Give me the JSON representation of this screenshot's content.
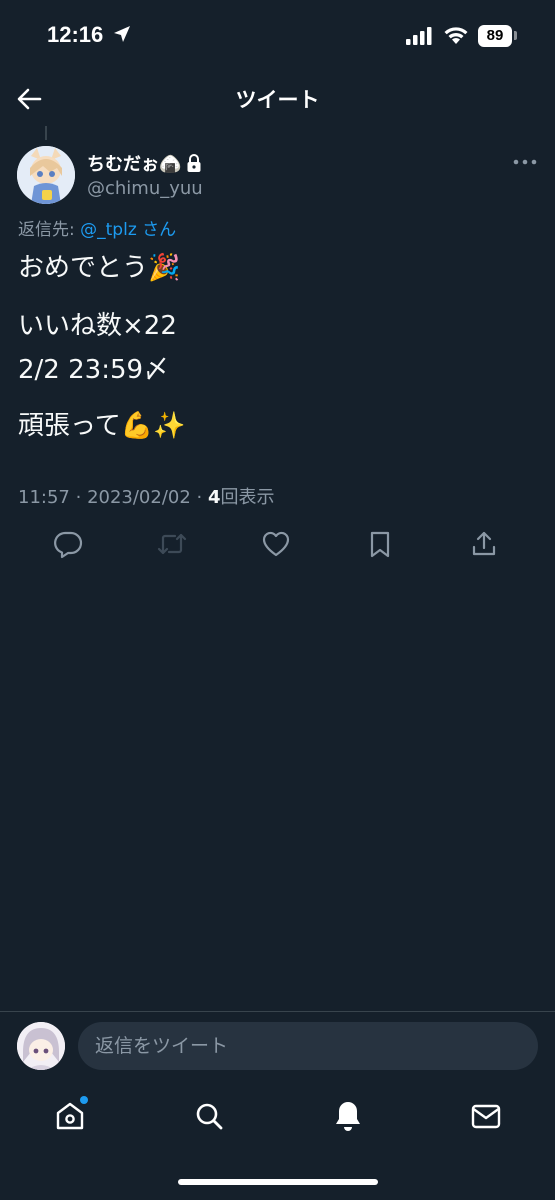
{
  "status_bar": {
    "time": "12:16",
    "battery": "89"
  },
  "header": {
    "title": "ツイート"
  },
  "tweet": {
    "display_name": "ちむだぉ🍙",
    "handle": "@chimu_yuu",
    "reply_prefix": "返信先: ",
    "reply_mention": "@_tplz",
    "reply_suffix": " さん",
    "lines": [
      "おめでとう🎉",
      "いいね数×22",
      "2/2 23:59〆",
      "頑張って💪✨"
    ],
    "time": "11:57",
    "date": "2023/02/02",
    "view_count": "4",
    "view_label": "回表示"
  },
  "compose": {
    "placeholder": "返信をツイート"
  },
  "colors": {
    "background": "#15202b",
    "accent": "#1d9bf0",
    "secondary_text": "#8b98a5"
  },
  "icons": {
    "reply": "comment-icon",
    "retweet": "retweet-icon",
    "like": "heart-icon",
    "bookmark": "bookmark-icon",
    "share": "share-icon",
    "home": "home-icon",
    "search": "search-icon",
    "notifications": "bell-icon",
    "messages": "mail-icon"
  }
}
